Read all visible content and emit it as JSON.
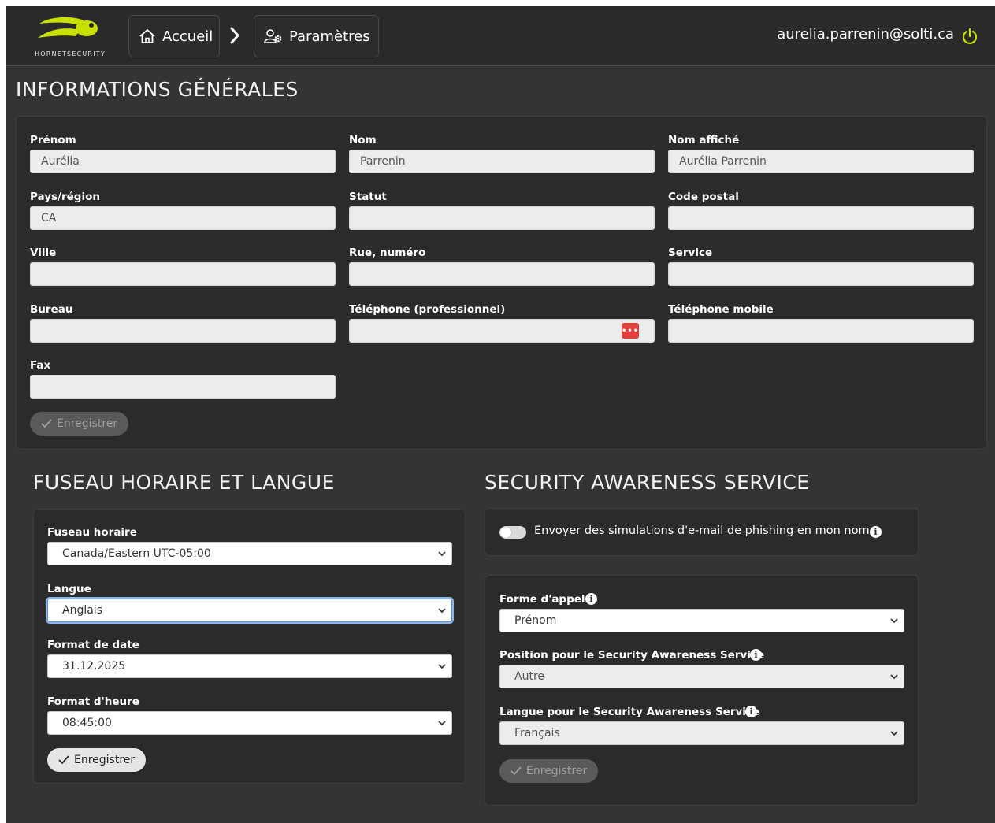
{
  "brand": {
    "name": "HORNETSECURITY",
    "accent": "#c9e000"
  },
  "nav": {
    "home_label": "Accueil",
    "settings_label": "Paramètres",
    "user_email": "aurelia.parrenin@solti.ca"
  },
  "general": {
    "title": "INFORMATIONS GÉNÉRALES",
    "fields": {
      "prenom": {
        "label": "Prénom",
        "value": "Aurélia"
      },
      "nom": {
        "label": "Nom",
        "value": "Parrenin"
      },
      "nom_affiche": {
        "label": "Nom affiché",
        "value": "Aurélia Parrenin"
      },
      "pays": {
        "label": "Pays/région",
        "value": "CA"
      },
      "statut": {
        "label": "Statut",
        "value": ""
      },
      "code_postal": {
        "label": "Code postal",
        "value": ""
      },
      "ville": {
        "label": "Ville",
        "value": ""
      },
      "rue": {
        "label": "Rue, numéro",
        "value": ""
      },
      "service": {
        "label": "Service",
        "value": ""
      },
      "bureau": {
        "label": "Bureau",
        "value": ""
      },
      "tel_pro": {
        "label": "Téléphone (professionnel)",
        "value": ""
      },
      "tel_mobile": {
        "label": "Téléphone mobile",
        "value": ""
      },
      "fax": {
        "label": "Fax",
        "value": ""
      }
    },
    "save_label": "Enregistrer"
  },
  "timezone": {
    "title": "FUSEAU HORAIRE ET LANGUE",
    "fuseau_label": "Fuseau horaire",
    "fuseau_value": "Canada/Eastern UTC-05:00",
    "langue_label": "Langue",
    "langue_value": "Anglais",
    "date_label": "Format de date",
    "date_value": "31.12.2025",
    "heure_label": "Format d'heure",
    "heure_value": "08:45:00",
    "save_label": "Enregistrer"
  },
  "awareness": {
    "title": "SECURITY AWARENESS SERVICE",
    "toggle_label": "Envoyer des simulations d'e-mail de phishing en mon nom",
    "toggle_on": false,
    "forme_label": "Forme d'appel",
    "forme_value": "Prénom",
    "position_label": "Position pour le Security Awareness Service",
    "position_value": "Autre",
    "langue_label": "Langue pour le Security Awareness Service",
    "langue_value": "Français",
    "save_label": "Enregistrer"
  }
}
